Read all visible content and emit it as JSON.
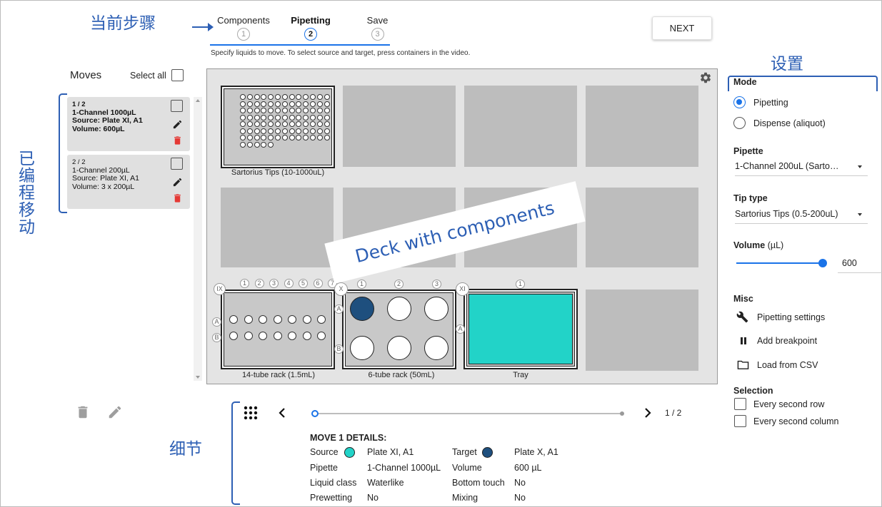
{
  "annotations": {
    "current_step": "当前步骤",
    "settings": "设置",
    "edited_moves": "已编程移动",
    "details": "细节",
    "deck_banner": "Deck with components"
  },
  "steps": [
    {
      "label": "Components",
      "num": "1",
      "active": false
    },
    {
      "label": "Pipetting",
      "num": "2",
      "active": true
    },
    {
      "label": "Save",
      "num": "3",
      "active": false
    }
  ],
  "next_label": "NEXT",
  "instructions": "Specify liquids to move. To select source and target, press containers in the video.",
  "moves_panel": {
    "title": "Moves",
    "select_all": "Select all",
    "items": [
      {
        "index": "1 / 2",
        "pipette": "1-Channel 1000µL",
        "source": "Source: Plate XI, A1",
        "volume": "Volume: 600µL",
        "bold": true
      },
      {
        "index": "2 / 2",
        "pipette": "1-Channel 200µL",
        "source": "Source: Plate XI, A1",
        "volume": "Volume: 3 x 200µL",
        "bold": false
      }
    ]
  },
  "deck": {
    "labels": {
      "tips": "Sartorius Tips (10-1000uL)",
      "rack14": "14-tube rack (1.5mL)",
      "rack6": "6-tube rack (50mL)",
      "tray": "Tray"
    },
    "slot_ids": {
      "ix": "IX",
      "x": "X",
      "xi": "XI"
    },
    "rack14_cols": [
      "1",
      "2",
      "3",
      "4",
      "5",
      "6",
      "7"
    ],
    "rack6_cols": [
      "1",
      "2",
      "3"
    ],
    "tray_cols": [
      "1"
    ],
    "rows": [
      "A",
      "B"
    ],
    "colors": {
      "target_well": "#1e4f7e",
      "tray": "#22d3c8"
    }
  },
  "settings": {
    "mode_title": "Mode",
    "mode_options": [
      {
        "label": "Pipetting",
        "selected": true
      },
      {
        "label": "Dispense (aliquot)",
        "selected": false
      }
    ],
    "pipette_title": "Pipette",
    "pipette_value": "1-Channel 200uL (Sarto…",
    "tip_title": "Tip type",
    "tip_value": "Sartorius Tips (0.5-200uL)",
    "volume_title": "Volume",
    "volume_unit": "(µL)",
    "volume_value": "600",
    "volume_fraction": 0.98,
    "misc_title": "Misc",
    "misc_items": [
      {
        "label": "Pipetting settings",
        "icon": "wrench-icon"
      },
      {
        "label": "Add breakpoint",
        "icon": "pause-icon"
      },
      {
        "label": "Load from CSV",
        "icon": "folder-icon"
      }
    ],
    "selection_title": "Selection",
    "selection_items": [
      "Every second row",
      "Every second column"
    ]
  },
  "playback": {
    "position": "1 / 2",
    "fraction": 0.0
  },
  "details": {
    "title": "MOVE 1 DETAILS:",
    "rows": [
      [
        "Source",
        "Plate XI, A1",
        "Target",
        "Plate X, A1"
      ],
      [
        "Pipette",
        "1-Channel 1000µL",
        "Volume",
        "600 µL"
      ],
      [
        "Liquid class",
        "Waterlike",
        "Bottom touch",
        "No"
      ],
      [
        "Prewetting",
        "No",
        "Mixing",
        "No"
      ]
    ],
    "source_color": "#22d3c8",
    "target_color": "#1e4f7e"
  },
  "colors": {
    "accent": "#1a73e8",
    "annotation": "#2d5fb4",
    "delete": "#e53935"
  }
}
